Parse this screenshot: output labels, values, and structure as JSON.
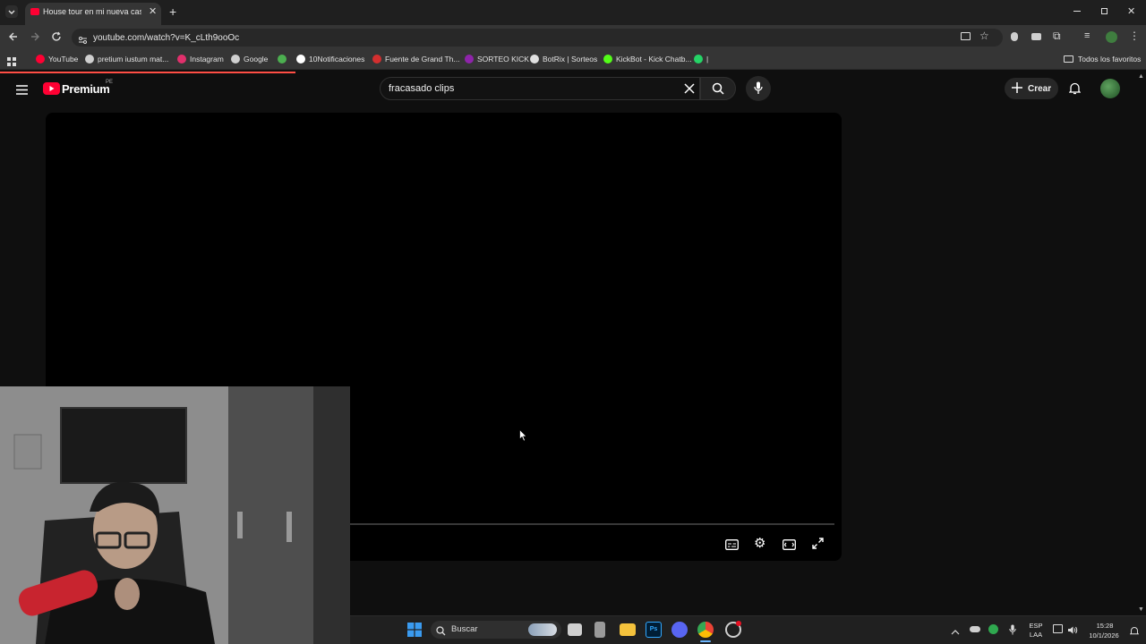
{
  "browser": {
    "tab_title": "House tour en mi nueva casa e",
    "url": "youtube.com/watch?v=K_cLth9ooOc",
    "bookmarks": [
      {
        "label": "YouTube",
        "icon": "youtube-icon",
        "color": "#ff0033"
      },
      {
        "label": "pretium iustum mat...",
        "icon": "globe-icon",
        "color": "#cfcfcf"
      },
      {
        "label": "Instagram",
        "icon": "instagram-icon",
        "color": "#e1306c"
      },
      {
        "label": "Google",
        "icon": "google-icon",
        "color": "#cfcfcf"
      },
      {
        "label": "",
        "icon": "pinwheel-icon",
        "color": "#4caf50"
      },
      {
        "label": "10Notificaciones",
        "icon": "x-logo-icon",
        "color": "#ffffff"
      },
      {
        "label": "Fuente de Grand Th...",
        "icon": "font-f-icon",
        "color": "#d32f2f"
      },
      {
        "label": "SORTEO KICK",
        "icon": "dot-icon",
        "color": "#8e24aa"
      },
      {
        "label": "BotRix | Sorteos",
        "icon": "diamond-icon",
        "color": "#e0e0e0"
      },
      {
        "label": "KickBot - Kick Chatb...",
        "icon": "kick-icon",
        "color": "#53fc18"
      },
      {
        "label": "|",
        "icon": "whatsapp-icon",
        "color": "#25d366"
      }
    ],
    "all_bookmarks": "Todos los favoritos"
  },
  "youtube": {
    "logo_text": "Premium",
    "region": "PE",
    "search_value": "fracasado clips",
    "create_label": "Crear"
  },
  "taskbar": {
    "search_label": "Buscar",
    "lang_top": "ESP",
    "lang_bottom": "LAA",
    "time": "15:28",
    "date": "10/1/2026"
  }
}
